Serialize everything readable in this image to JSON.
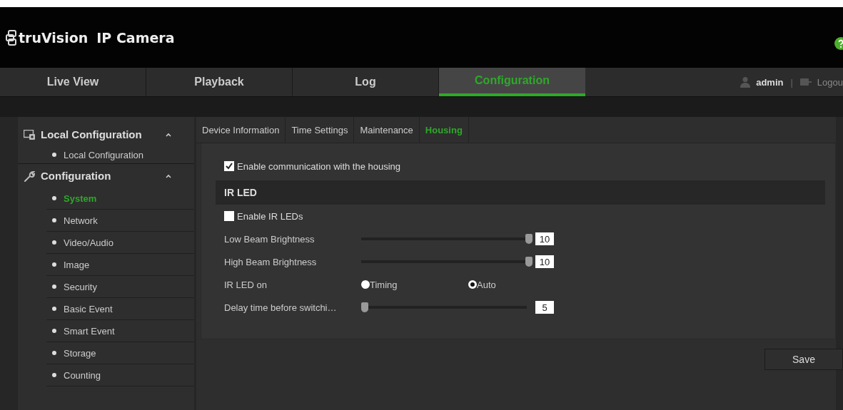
{
  "header": {
    "brand": "truVision",
    "title": "IP Camera"
  },
  "nav": {
    "tabs": [
      {
        "label": "Live View",
        "selected": false
      },
      {
        "label": "Playback",
        "selected": false
      },
      {
        "label": "Log",
        "selected": false
      },
      {
        "label": "Configuration",
        "selected": true
      }
    ],
    "user": "admin",
    "separator": "|",
    "logout": "Logou"
  },
  "sidebar": {
    "groups": [
      {
        "label": "Local Configuration",
        "expanded": true,
        "items": [
          {
            "label": "Local Configuration",
            "selected": false
          }
        ]
      },
      {
        "label": "Configuration",
        "expanded": true,
        "items": [
          {
            "label": "System",
            "selected": true
          },
          {
            "label": "Network",
            "selected": false
          },
          {
            "label": "Video/Audio",
            "selected": false
          },
          {
            "label": "Image",
            "selected": false
          },
          {
            "label": "Security",
            "selected": false
          },
          {
            "label": "Basic Event",
            "selected": false
          },
          {
            "label": "Smart Event",
            "selected": false
          },
          {
            "label": "Storage",
            "selected": false
          },
          {
            "label": "Counting",
            "selected": false
          }
        ]
      }
    ]
  },
  "subtabs": [
    {
      "label": "Device Information",
      "selected": false
    },
    {
      "label": "Time Settings",
      "selected": false
    },
    {
      "label": "Maintenance",
      "selected": false
    },
    {
      "label": "Housing",
      "selected": true
    }
  ],
  "form": [
    {
      "kind": "checkbox",
      "label": "Enable communication with the housing",
      "checked": true
    },
    {
      "kind": "section",
      "label": "IR LED"
    },
    {
      "kind": "checkbox",
      "label": "Enable IR LEDs",
      "checked": false
    },
    {
      "kind": "slider",
      "label": "Low Beam Brightness",
      "level": 1,
      "value": "10"
    },
    {
      "kind": "slider",
      "label": "High Beam Brightness",
      "level": 1,
      "value": "10"
    },
    {
      "kind": "radio",
      "label": "IR LED on",
      "options": [
        {
          "label": "Timing",
          "selected": false
        },
        {
          "label": "Auto",
          "selected": true
        }
      ]
    },
    {
      "kind": "slider",
      "label": "Delay time before switchi…",
      "level": 0,
      "value": "5"
    }
  ],
  "save": "Save"
}
